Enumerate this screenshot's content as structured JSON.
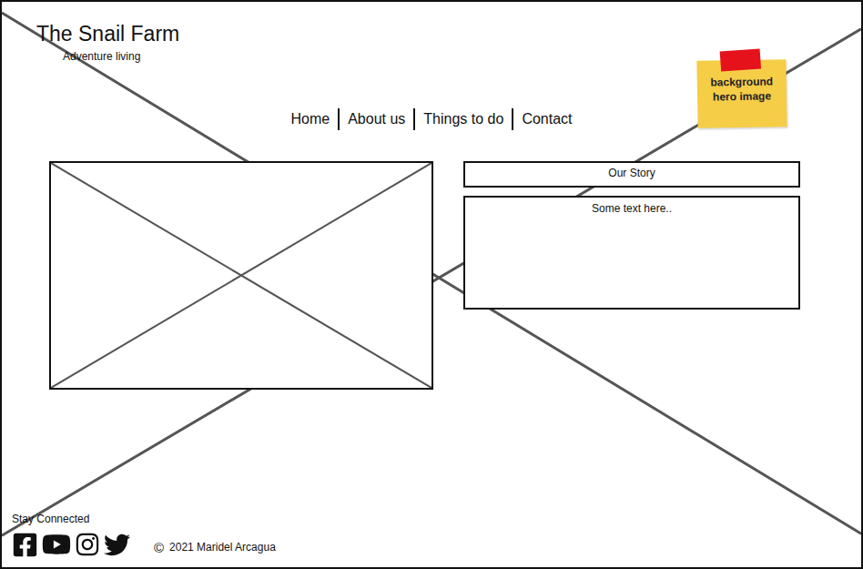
{
  "header": {
    "title": "The Snail Farm",
    "tagline": "Adventure living"
  },
  "nav": {
    "items": [
      {
        "label": "Home"
      },
      {
        "label": "About us"
      },
      {
        "label": "Things to do"
      },
      {
        "label": "Contact"
      }
    ]
  },
  "sticky_note": {
    "lines": [
      "background",
      "hero image"
    ]
  },
  "content": {
    "story_title": "Our Story",
    "story_text": "Some text here.."
  },
  "footer": {
    "stay_connected": "Stay Connected",
    "copyright_symbol": "©",
    "copyright": "2021 Maridel Arcagua"
  }
}
